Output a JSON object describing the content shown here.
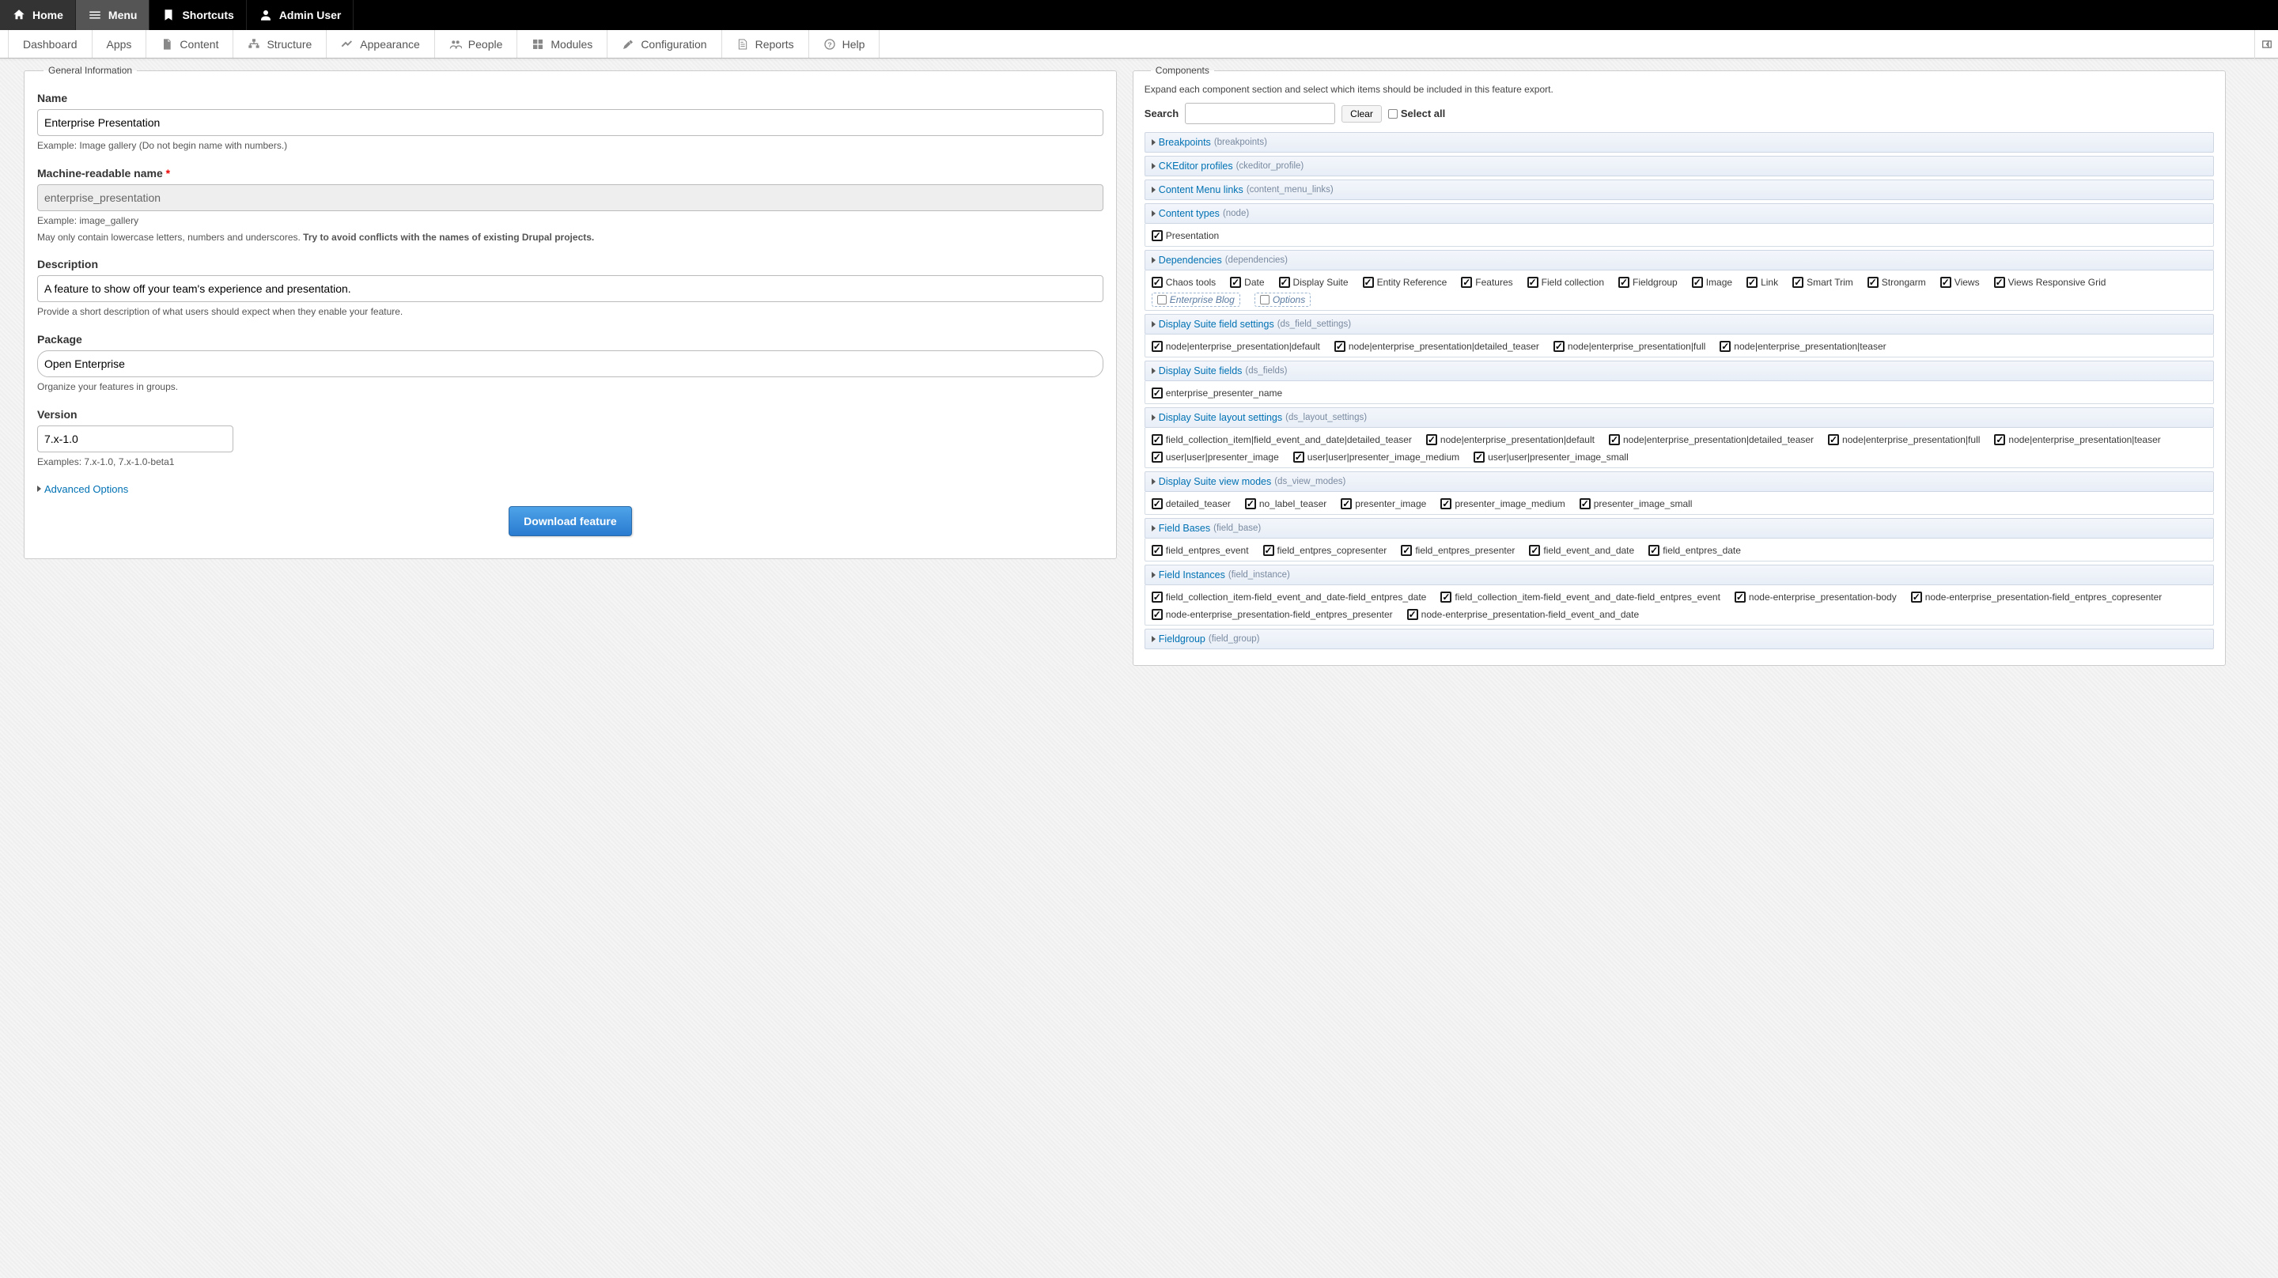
{
  "toolbar_black": {
    "home": "Home",
    "menu": "Menu",
    "shortcuts": "Shortcuts",
    "admin_user": "Admin User"
  },
  "toolbar_white": {
    "dashboard": "Dashboard",
    "apps": "Apps",
    "content": "Content",
    "structure": "Structure",
    "appearance": "Appearance",
    "people": "People",
    "modules": "Modules",
    "configuration": "Configuration",
    "reports": "Reports",
    "help": "Help"
  },
  "panels": {
    "general_legend": "General Information",
    "components_legend": "Components"
  },
  "form": {
    "name": {
      "label": "Name",
      "value": "Enterprise Presentation",
      "hint": "Example: Image gallery (Do not begin name with numbers.)"
    },
    "machine": {
      "label": "Machine-readable name",
      "required": "*",
      "value": "enterprise_presentation",
      "hint1": "Example: image_gallery",
      "hint2_a": "May only contain lowercase letters, numbers and underscores. ",
      "hint2_b": "Try to avoid conflicts with the names of existing Drupal projects."
    },
    "description": {
      "label": "Description",
      "value": "A feature to show off your team's experience and presentation.",
      "hint": "Provide a short description of what users should expect when they enable your feature."
    },
    "package": {
      "label": "Package",
      "value": "Open Enterprise",
      "hint": "Organize your features in groups."
    },
    "version": {
      "label": "Version",
      "value": "7.x-1.0",
      "hint": "Examples: 7.x-1.0, 7.x-1.0-beta1"
    },
    "advanced": "Advanced Options",
    "download": "Download feature"
  },
  "components": {
    "intro": "Expand each component section and select which items should be included in this feature export.",
    "search_label": "Search",
    "clear": "Clear",
    "select_all": "Select all",
    "sections": [
      {
        "name": "Breakpoints",
        "mach": "(breakpoints)",
        "items": []
      },
      {
        "name": "CKEditor profiles",
        "mach": "(ckeditor_profile)",
        "items": []
      },
      {
        "name": "Content Menu links",
        "mach": "(content_menu_links)",
        "items": []
      },
      {
        "name": "Content types",
        "mach": "(node)",
        "items": [
          {
            "label": "Presentation",
            "checked": true
          }
        ]
      },
      {
        "name": "Dependencies",
        "mach": "(dependencies)",
        "items": [
          {
            "label": "Chaos tools",
            "checked": true
          },
          {
            "label": "Date",
            "checked": true
          },
          {
            "label": "Display Suite",
            "checked": true
          },
          {
            "label": "Entity Reference",
            "checked": true
          },
          {
            "label": "Features",
            "checked": true
          },
          {
            "label": "Field collection",
            "checked": true
          },
          {
            "label": "Fieldgroup",
            "checked": true
          },
          {
            "label": "Image",
            "checked": true
          },
          {
            "label": "Link",
            "checked": true
          },
          {
            "label": "Smart Trim",
            "checked": true
          },
          {
            "label": "Strongarm",
            "checked": true
          },
          {
            "label": "Views",
            "checked": true
          },
          {
            "label": "Views Responsive Grid",
            "checked": true
          },
          {
            "label": "Enterprise Blog",
            "checked": false
          },
          {
            "label": "Options",
            "checked": false
          }
        ]
      },
      {
        "name": "Display Suite field settings",
        "mach": "(ds_field_settings)",
        "items": [
          {
            "label": "node|enterprise_presentation|default",
            "checked": true
          },
          {
            "label": "node|enterprise_presentation|detailed_teaser",
            "checked": true
          },
          {
            "label": "node|enterprise_presentation|full",
            "checked": true
          },
          {
            "label": "node|enterprise_presentation|teaser",
            "checked": true
          }
        ]
      },
      {
        "name": "Display Suite fields",
        "mach": "(ds_fields)",
        "items": [
          {
            "label": "enterprise_presenter_name",
            "checked": true
          }
        ]
      },
      {
        "name": "Display Suite layout settings",
        "mach": "(ds_layout_settings)",
        "items": [
          {
            "label": "field_collection_item|field_event_and_date|detailed_teaser",
            "checked": true
          },
          {
            "label": "node|enterprise_presentation|default",
            "checked": true
          },
          {
            "label": "node|enterprise_presentation|detailed_teaser",
            "checked": true
          },
          {
            "label": "node|enterprise_presentation|full",
            "checked": true
          },
          {
            "label": "node|enterprise_presentation|teaser",
            "checked": true
          },
          {
            "label": "user|user|presenter_image",
            "checked": true
          },
          {
            "label": "user|user|presenter_image_medium",
            "checked": true
          },
          {
            "label": "user|user|presenter_image_small",
            "checked": true
          }
        ]
      },
      {
        "name": "Display Suite view modes",
        "mach": "(ds_view_modes)",
        "items": [
          {
            "label": "detailed_teaser",
            "checked": true
          },
          {
            "label": "no_label_teaser",
            "checked": true
          },
          {
            "label": "presenter_image",
            "checked": true
          },
          {
            "label": "presenter_image_medium",
            "checked": true
          },
          {
            "label": "presenter_image_small",
            "checked": true
          }
        ]
      },
      {
        "name": "Field Bases",
        "mach": "(field_base)",
        "items": [
          {
            "label": "field_entpres_event",
            "checked": true
          },
          {
            "label": "field_entpres_copresenter",
            "checked": true
          },
          {
            "label": "field_entpres_presenter",
            "checked": true
          },
          {
            "label": "field_event_and_date",
            "checked": true
          },
          {
            "label": "field_entpres_date",
            "checked": true
          }
        ]
      },
      {
        "name": "Field Instances",
        "mach": "(field_instance)",
        "items": [
          {
            "label": "field_collection_item-field_event_and_date-field_entpres_date",
            "checked": true
          },
          {
            "label": "field_collection_item-field_event_and_date-field_entpres_event",
            "checked": true
          },
          {
            "label": "node-enterprise_presentation-body",
            "checked": true
          },
          {
            "label": "node-enterprise_presentation-field_entpres_copresenter",
            "checked": true
          },
          {
            "label": "node-enterprise_presentation-field_entpres_presenter",
            "checked": true
          },
          {
            "label": "node-enterprise_presentation-field_event_and_date",
            "checked": true
          }
        ]
      },
      {
        "name": "Fieldgroup",
        "mach": "(field_group)",
        "items": []
      }
    ]
  }
}
